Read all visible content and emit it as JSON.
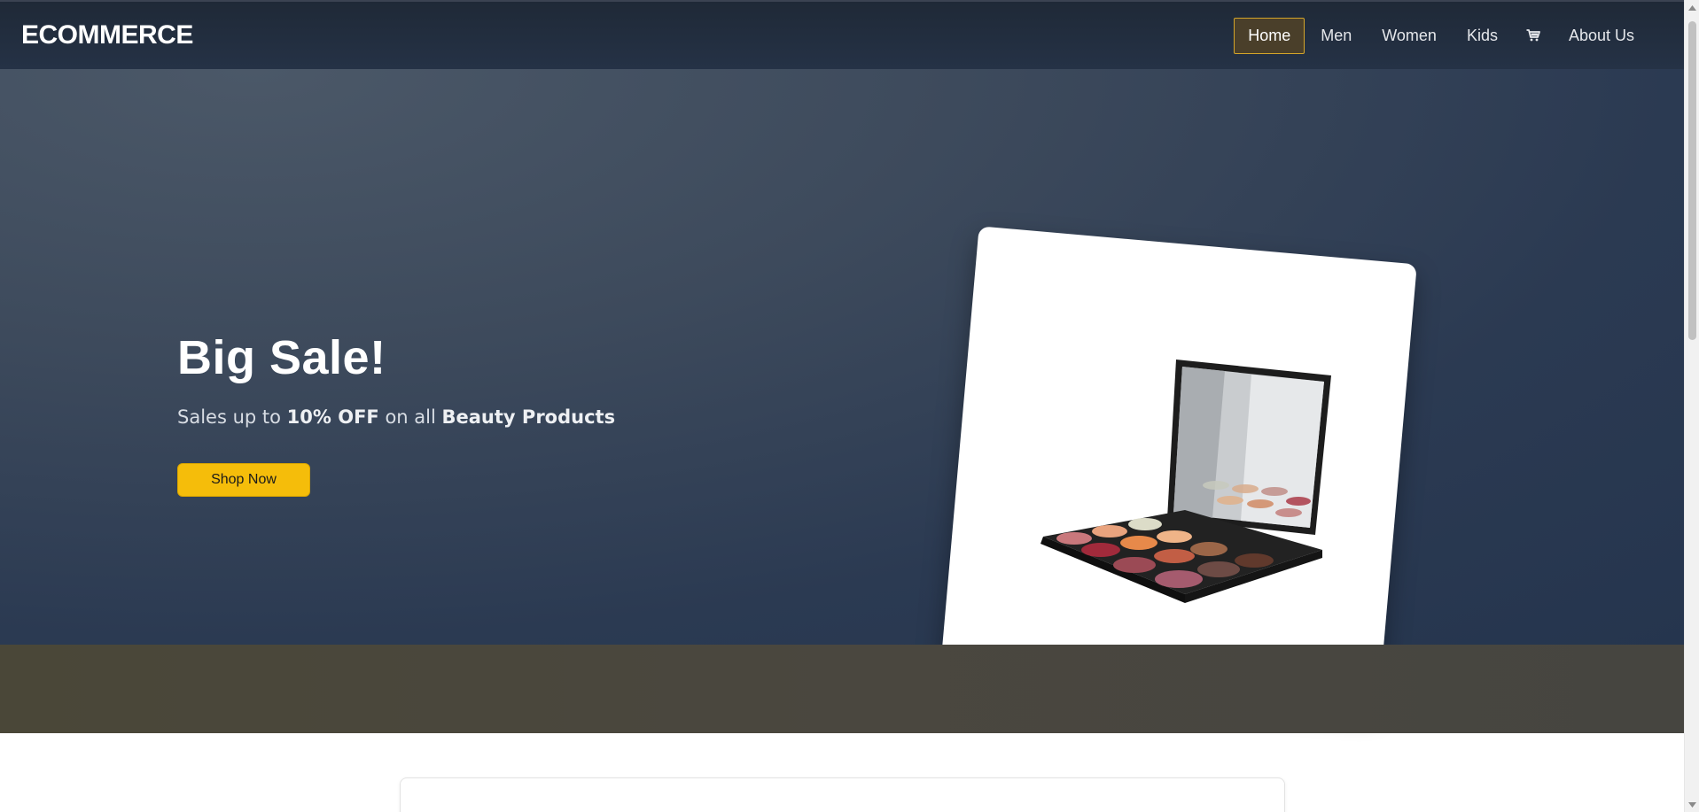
{
  "navbar": {
    "brand": "ECOMMERCE",
    "items": [
      {
        "label": "Home",
        "active": true
      },
      {
        "label": "Men",
        "active": false
      },
      {
        "label": "Women",
        "active": false
      },
      {
        "label": "Kids",
        "active": false
      }
    ],
    "cart_icon": "cart-icon",
    "about_label": "About Us"
  },
  "hero": {
    "title": "Big Sale!",
    "subtitle_prefix": "Sales up to ",
    "subtitle_discount": "10% OFF",
    "subtitle_middle": " on all ",
    "subtitle_category": "Beauty Products",
    "cta_label": "Shop Now",
    "product_image": "eyeshadow-palette-image"
  },
  "colors": {
    "accent": "#f5bd0a",
    "active_border": "#d4a52a",
    "navbar_bg": "#1f2937",
    "hero_bg": "#2b3a52"
  }
}
